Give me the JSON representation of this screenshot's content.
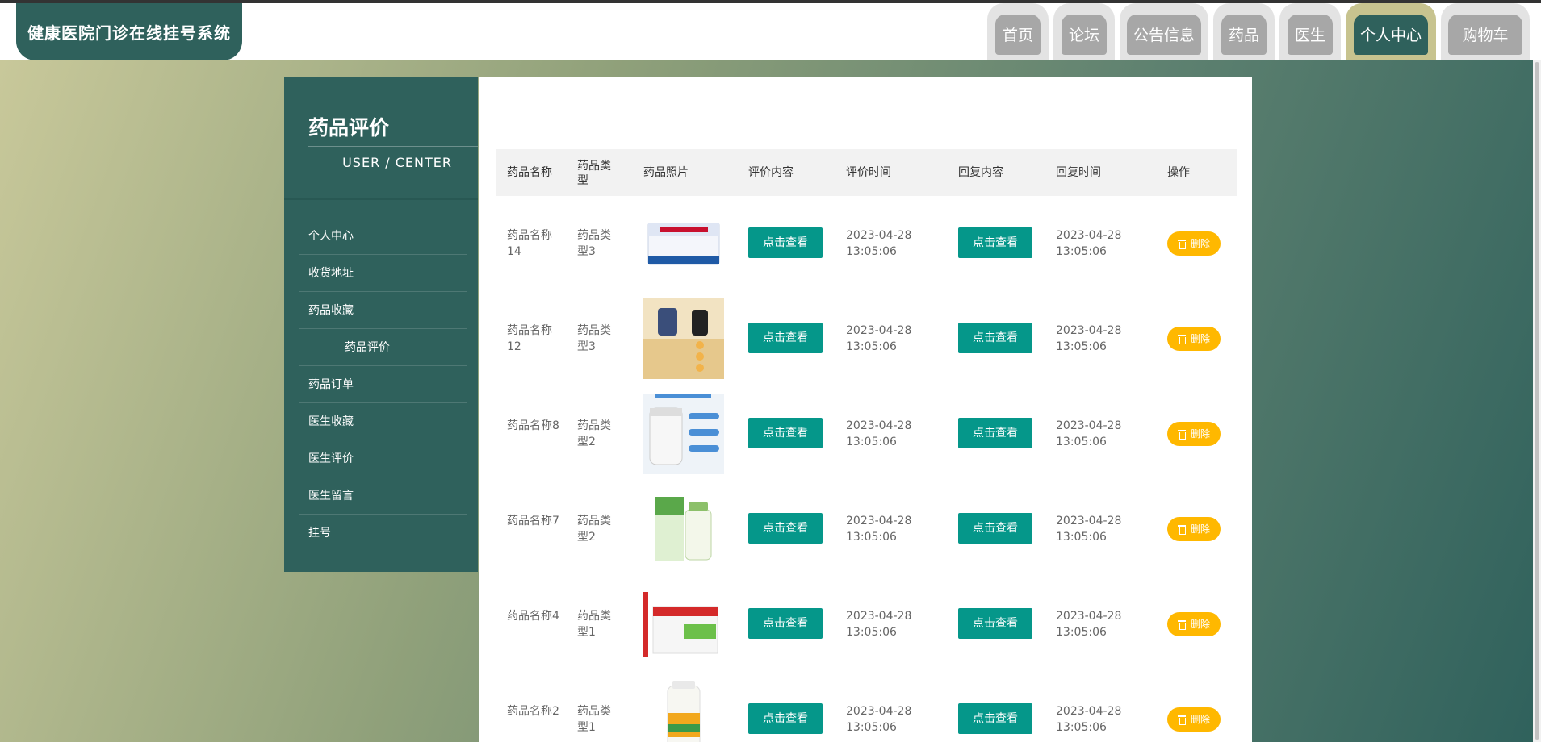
{
  "header": {
    "site_title": "健康医院门诊在线挂号系统",
    "nav": [
      {
        "label": "首页"
      },
      {
        "label": "论坛"
      },
      {
        "label": "公告信息"
      },
      {
        "label": "药品"
      },
      {
        "label": "医生"
      },
      {
        "label": "个人中心",
        "active": true
      },
      {
        "label": "购物车"
      }
    ]
  },
  "sidebar": {
    "title": "药品评价",
    "subtitle": "USER / CENTER",
    "items": [
      {
        "label": "个人中心"
      },
      {
        "label": "收货地址"
      },
      {
        "label": "药品收藏"
      },
      {
        "label": "药品评价",
        "active": true
      },
      {
        "label": "药品订单"
      },
      {
        "label": "医生收藏"
      },
      {
        "label": "医生评价"
      },
      {
        "label": "医生留言"
      },
      {
        "label": "挂号"
      }
    ]
  },
  "table": {
    "headers": [
      "药品名称",
      "药品类型",
      "药品照片",
      "评价内容",
      "评价时间",
      "回复内容",
      "回复时间",
      "操作"
    ],
    "view_label": "点击查看",
    "delete_label": "删除",
    "rows": [
      {
        "name": "药品名称14",
        "type": "药品类型3",
        "image": "white-blue-medicine-box",
        "eval_time": "2023-04-28 13:05:06",
        "reply_time": "2023-04-28 13:05:06"
      },
      {
        "name": "药品名称12",
        "type": "药品类型3",
        "image": "supplement-bottles",
        "eval_time": "2023-04-28 13:05:06",
        "reply_time": "2023-04-28 13:05:06"
      },
      {
        "name": "药品名称8",
        "type": "药品类型2",
        "image": "pill-bottle-infographic",
        "eval_time": "2023-04-28 13:05:06",
        "reply_time": "2023-04-28 13:05:06"
      },
      {
        "name": "药品名称7",
        "type": "药品类型2",
        "image": "green-supplement-set",
        "eval_time": "2023-04-28 13:05:06",
        "reply_time": "2023-04-28 13:05:06"
      },
      {
        "name": "药品名称4",
        "type": "药品类型1",
        "image": "red-green-medicine-box",
        "eval_time": "2023-04-28 13:05:06",
        "reply_time": "2023-04-28 13:05:06"
      },
      {
        "name": "药品名称2",
        "type": "药品类型1",
        "image": "vitamin-bottle",
        "eval_time": "2023-04-28 13:05:06",
        "reply_time": "2023-04-28 13:05:06"
      }
    ]
  },
  "colors": {
    "primary": "#2f615c",
    "button": "#05978a",
    "delete": "#ffb800"
  }
}
